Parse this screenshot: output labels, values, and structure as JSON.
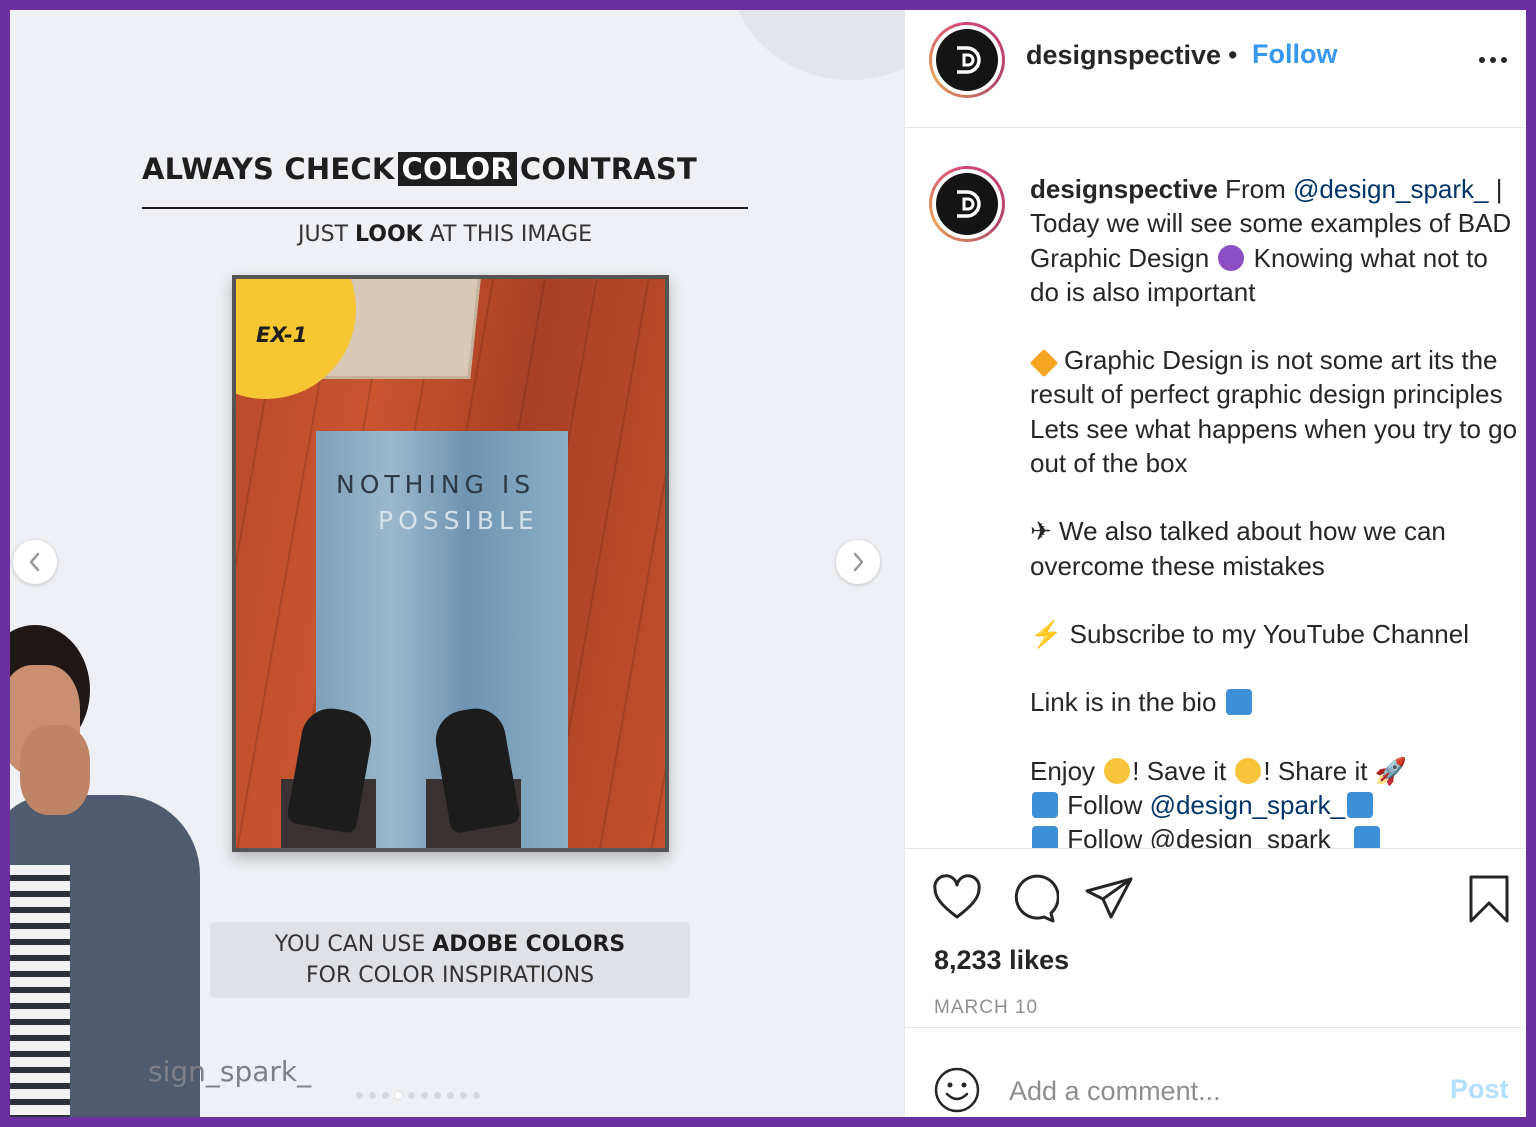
{
  "colors": {
    "frame": "#6b2fa0",
    "follow": "#3897f0",
    "post_disabled": "#b2dffc",
    "mention": "#003569",
    "badge": "#f6c633"
  },
  "slide": {
    "headline_pre": "ALWAYS CHECK",
    "headline_box": "COLOR",
    "headline_post": "CONTRAST",
    "sub_pre": "JUST ",
    "sub_bold": "LOOK",
    "sub_post": " AT THIS IMAGE",
    "badge": "EX-1",
    "mat_line1": "NOTHING IS",
    "mat_line2": "POSSIBLE",
    "tip_pre": "YOU CAN USE ",
    "tip_bold": "ADOBE COLORS",
    "tip_line2": "FOR COLOR INSPIRATIONS",
    "watermark": "sign_spark_",
    "prev_icon": "chevron-left-icon",
    "next_icon": "chevron-right-icon",
    "carousel": {
      "count": 10,
      "active_index": 3
    }
  },
  "header": {
    "username": "designspective",
    "separator": "•",
    "follow": "Follow",
    "more_icon": "more-horizontal-icon"
  },
  "caption": {
    "username": "designspective",
    "from_text": " From ",
    "mention": "@design_spark_",
    "intro": " | Today we will see some examples of BAD Graphic Design ",
    "intro_after": " Knowing what not to do is also important",
    "para1": "Graphic Design is not some art its the result of perfect graphic design principles Lets see what happens when you try to go out of the box",
    "para2_glyph": "✈",
    "para2": " We also talked about how we can overcome these mistakes",
    "para3_glyph": "⚡",
    "para3": " Subscribe to my YouTube Channel",
    "para4": "Link is in the bio ",
    "enjoy": "Enjoy ",
    "save_it": "! Save it ",
    "share_it": "! Share it ",
    "rocket": "🚀",
    "follow_line": " Follow ",
    "follow_mention": "@design_spark_",
    "follow_line2": " Follow @design_spark_ "
  },
  "actions": {
    "likes": "8,233 likes",
    "date": "MARCH 10",
    "icons": [
      "heart-icon",
      "comment-icon",
      "share-icon",
      "bookmark-icon"
    ]
  },
  "comment": {
    "placeholder": "Add a comment...",
    "post": "Post",
    "emoji_icon": "smiley-icon"
  }
}
